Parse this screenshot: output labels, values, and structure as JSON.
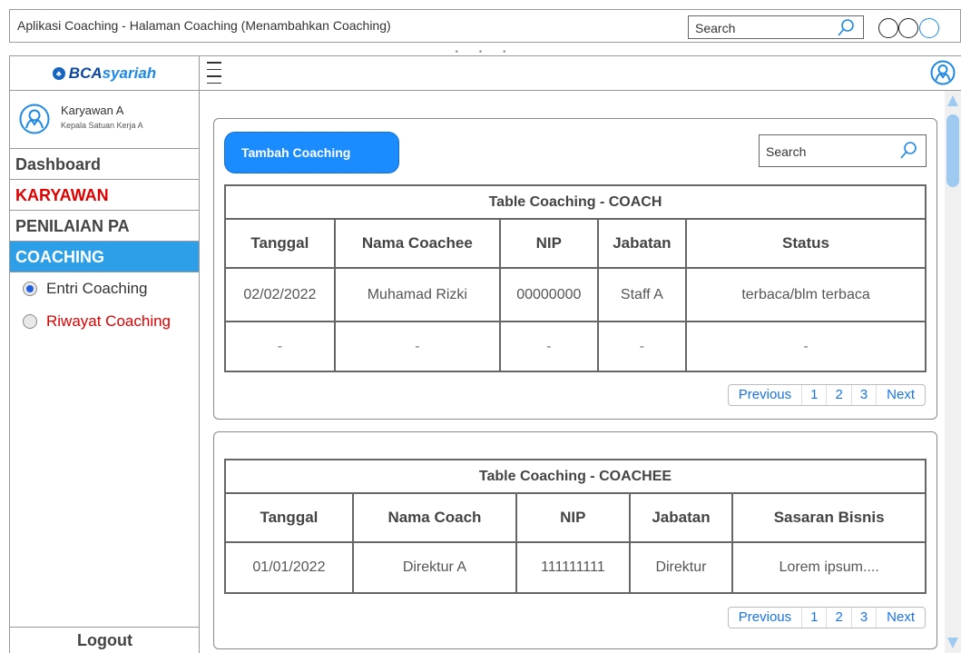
{
  "window": {
    "title": "Aplikasi Coaching -  Halaman Coaching (Menambahkan Coaching)",
    "search_placeholder": "Search",
    "drag_handle": "• • •"
  },
  "brand": {
    "logo_text_a": "BCA",
    "logo_text_b": "syariah"
  },
  "user": {
    "name": "Karyawan A",
    "role": "Kepala Satuan Kerja A"
  },
  "sidebar": {
    "items": [
      {
        "label": "Dashboard"
      },
      {
        "label": "KARYAWAN"
      },
      {
        "label": "PENILAIAN PA"
      },
      {
        "label": "COACHING"
      }
    ],
    "sub_items": [
      {
        "label": "Entri Coaching",
        "selected": true
      },
      {
        "label": "Riwayat Coaching",
        "selected": false
      }
    ],
    "logout_label": "Logout"
  },
  "coach_panel": {
    "add_button": "Tambah Coaching",
    "search_placeholder": "Search",
    "table_title": "Table Coaching - COACH",
    "columns": [
      "Tanggal",
      "Nama Coachee",
      "NIP",
      "Jabatan",
      "Status"
    ],
    "rows": [
      [
        "02/02/2022",
        "Muhamad Rizki",
        "00000000",
        "Staff A",
        "terbaca/blm terbaca"
      ],
      [
        "-",
        "-",
        "-",
        "-",
        "-"
      ]
    ],
    "pager": [
      "Previous",
      "1",
      "2",
      "3",
      "Next"
    ]
  },
  "coachee_panel": {
    "table_title": "Table Coaching - COACHEE",
    "columns": [
      "Tanggal",
      "Nama Coach",
      "NIP",
      "Jabatan",
      "Sasaran Bisnis"
    ],
    "rows": [
      [
        "01/01/2022",
        "Direktur A",
        "111111111",
        "Direktur",
        "Lorem ipsum...."
      ]
    ],
    "pager": [
      "Previous",
      "1",
      "2",
      "3",
      "Next"
    ]
  },
  "colors": {
    "accent": "#2d9ee8",
    "button": "#1a8cff",
    "alert_red": "#e00000",
    "link": "#1a73e8"
  }
}
